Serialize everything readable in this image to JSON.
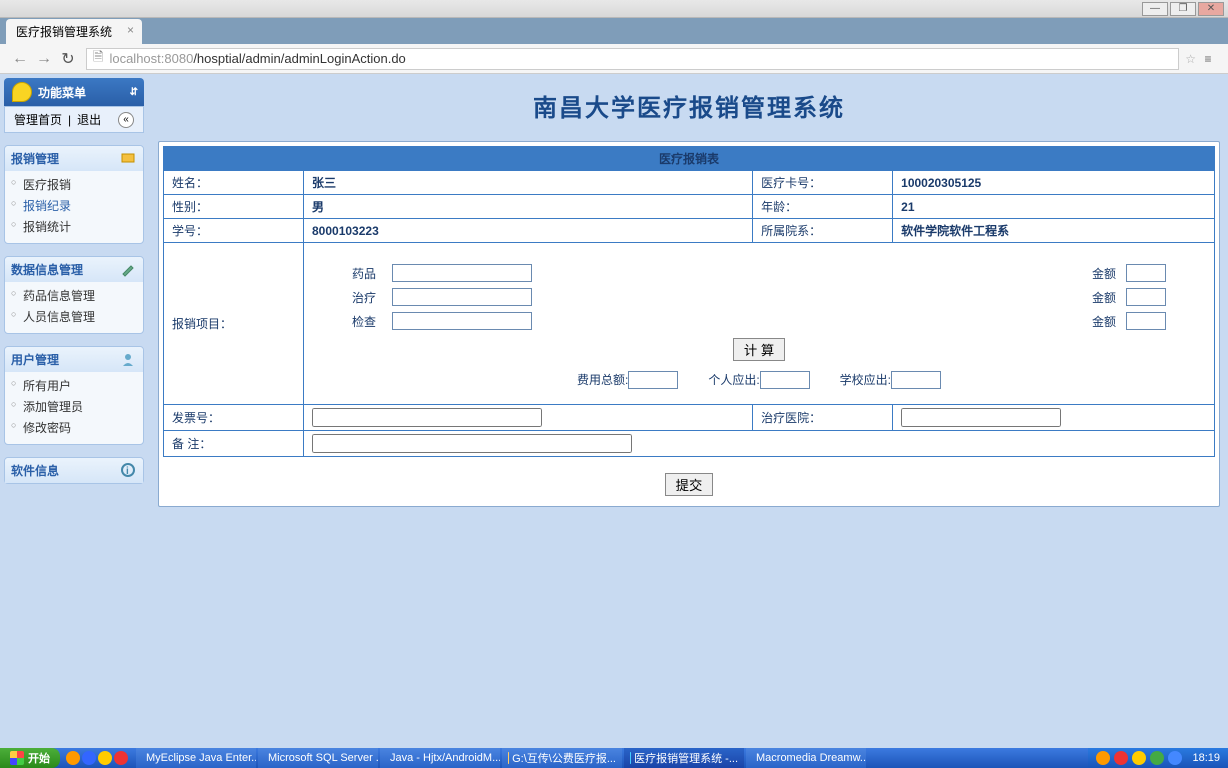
{
  "browser": {
    "tab_title": "医疗报销管理系统",
    "url_host": "localhost",
    "url_port": ":8080",
    "url_path": "/hosptial/admin/adminLoginAction.do"
  },
  "sidebar": {
    "header": "功能菜单",
    "nav": {
      "home": "管理首页",
      "exit": "退出"
    },
    "panels": [
      {
        "title": "报销管理",
        "items": [
          "医疗报销",
          "报销纪录",
          "报销统计"
        ],
        "active_index": 1
      },
      {
        "title": "数据信息管理",
        "items": [
          "药品信息管理",
          "人员信息管理"
        ]
      },
      {
        "title": "用户管理",
        "items": [
          "所有用户",
          "添加管理员",
          "修改密码"
        ]
      },
      {
        "title": "软件信息",
        "items": []
      }
    ]
  },
  "page_title": "南昌大学医疗报销管理系统",
  "form": {
    "title": "医疗报销表",
    "labels": {
      "name": "姓名：",
      "card": "医疗卡号：",
      "gender": "性别：",
      "age": "年龄：",
      "sid": "学号：",
      "dept": "所属院系：",
      "project": "报销项目：",
      "drug": "药品",
      "treat": "治疗",
      "check": "检查",
      "amount": "金额",
      "calc": "计 算",
      "total": "费用总额:",
      "personal": "个人应出:",
      "school": "学校应出:",
      "invoice": "发票号：",
      "hospital": "治疗医院：",
      "remark": "备 注："
    },
    "values": {
      "name": "张三",
      "card": "100020305125",
      "gender": "男",
      "age": "21",
      "sid": "8000103223",
      "dept": "软件学院软件工程系"
    },
    "submit": "提交"
  },
  "taskbar": {
    "start": "开始",
    "items": [
      "MyEclipse Java Enter...",
      "Microsoft SQL Server ...",
      "Java - Hjtx/AndroidM...",
      "G:\\互传\\公费医疗报...",
      "医疗报销管理系统 -...",
      "Macromedia Dreamw..."
    ],
    "active_index": 4,
    "clock": "18:19"
  }
}
